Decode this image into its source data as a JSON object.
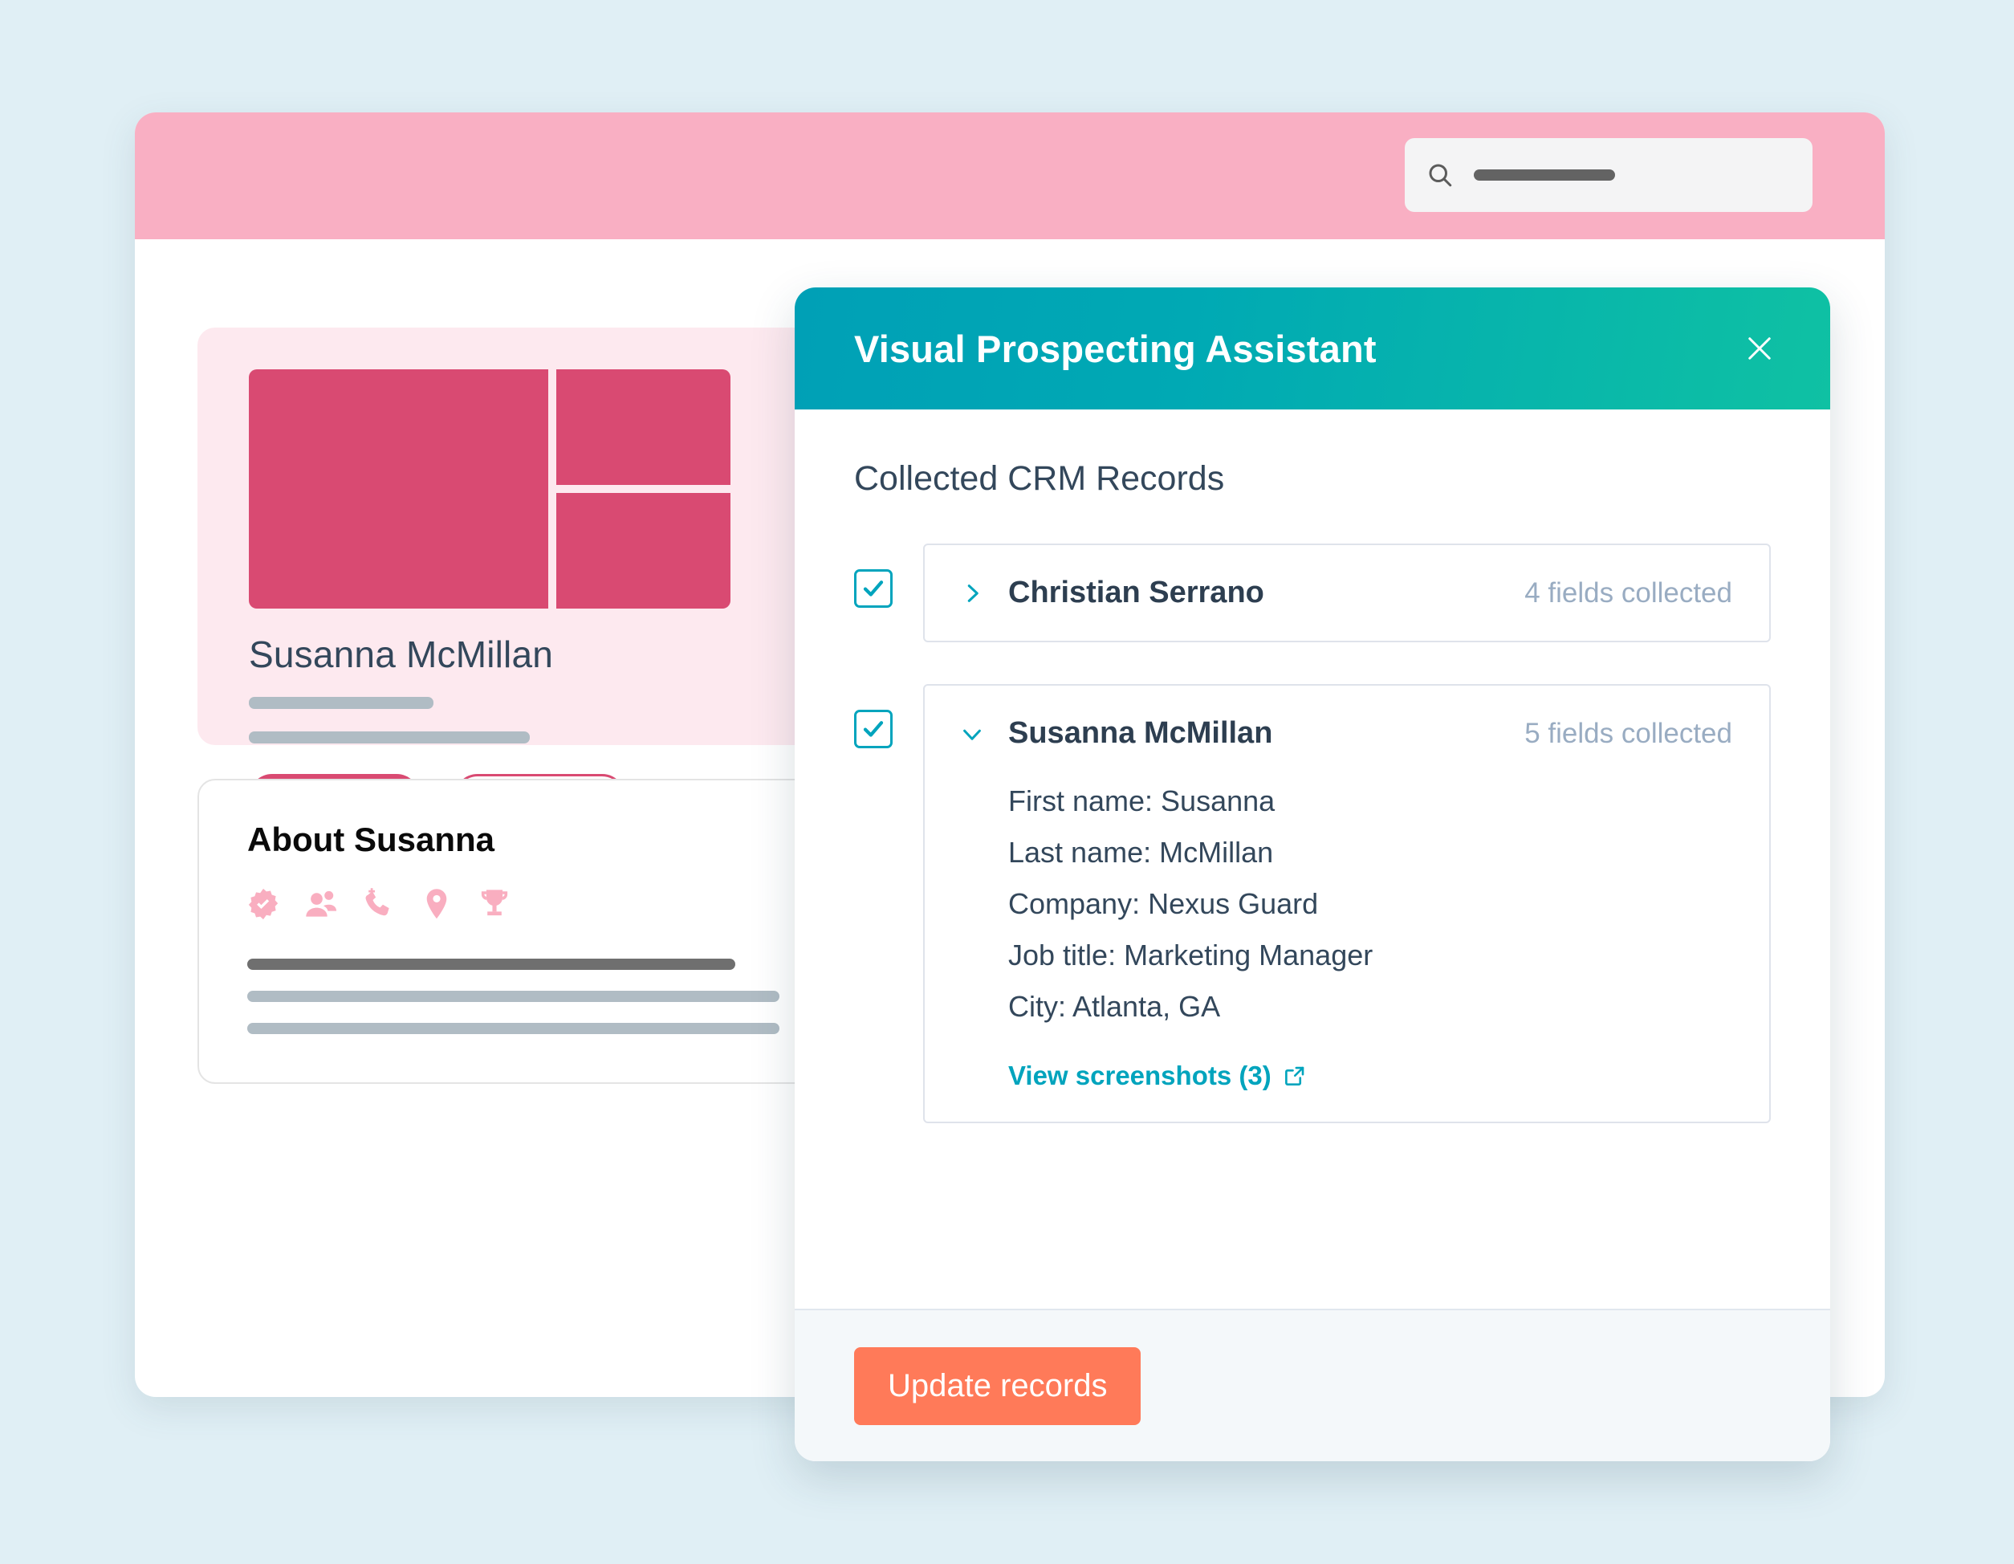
{
  "crm_app": {
    "search": {
      "icon": "search-icon",
      "placeholder": ""
    },
    "profile": {
      "name": "Susanna McMillan",
      "photo_placeholder": "profile-photo-placeholder",
      "primary_action": "",
      "secondary_action": ""
    },
    "about": {
      "title": "About Susanna",
      "icons": [
        "verified-badge-icon",
        "contacts-icon",
        "phone-add-icon",
        "location-pin-icon",
        "trophy-icon"
      ]
    }
  },
  "dialog": {
    "title": "Visual Prospecting Assistant",
    "close_icon": "close-icon",
    "section_title": "Collected CRM Records",
    "records": [
      {
        "name": "Christian Serrano",
        "count_label": "4 fields collected",
        "checked": true,
        "expanded": false,
        "chevron": "chevron-right-icon",
        "fields": []
      },
      {
        "name": "Susanna McMillan",
        "count_label": "5 fields collected",
        "checked": true,
        "expanded": true,
        "chevron": "chevron-down-icon",
        "fields": [
          "First name: Susanna",
          "Last name: McMillan",
          "Company: Nexus Guard",
          "Job title: Marketing Manager",
          "City: Atlanta, GA"
        ],
        "link_label": "View screenshots (3)",
        "link_icon": "external-link-icon"
      }
    ],
    "footer": {
      "primary_button": "Update records"
    }
  },
  "colors": {
    "page_background": "#e0eff5",
    "crm_topbar_pink": "#f9afc3",
    "profile_card_pink": "#fde9ef",
    "accent_magenta": "#d94a72",
    "teal": "#00a4bd",
    "gradient_green": "#0fc1a3",
    "coral": "#ff7a59",
    "text_slate": "#33475b",
    "muted_blue": "#99acc2",
    "card_border": "#dfe3eb"
  }
}
